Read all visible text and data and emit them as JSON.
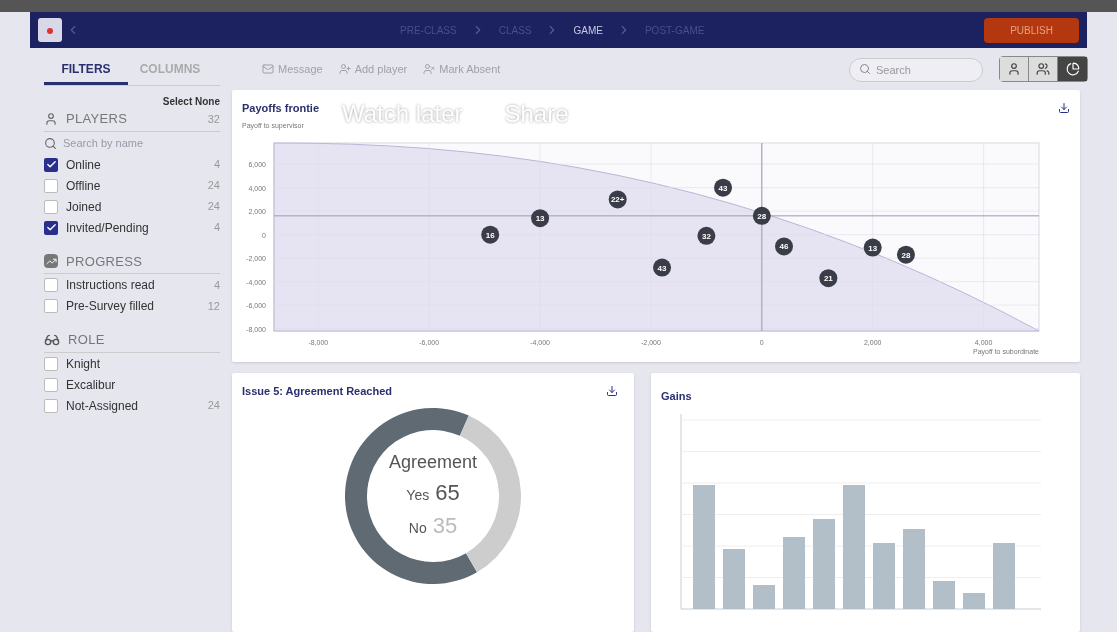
{
  "video_overlay": [
    "Watch later",
    "Share"
  ],
  "nav": {
    "steps": [
      {
        "label": "PRE-CLASS",
        "selected": false
      },
      {
        "label": "CLASS",
        "selected": false
      },
      {
        "label": "GAME",
        "selected": true
      },
      {
        "label": "POST-GAME",
        "selected": false
      }
    ],
    "publish": "PUBLISH"
  },
  "sidebar": {
    "tabs": [
      {
        "label": "FILTERS",
        "selected": true
      },
      {
        "label": "COLUMNS",
        "selected": false
      }
    ],
    "select_none": "Select None",
    "groups": [
      {
        "kind": "players",
        "title": "PLAYERS",
        "count": "32",
        "search_placeholder": "Search by name",
        "items": [
          {
            "label": "Online",
            "count": "4",
            "checked": true
          },
          {
            "label": "Offline",
            "count": "24",
            "checked": false
          },
          {
            "label": "Joined",
            "count": "24",
            "checked": false
          },
          {
            "label": "Invited/Pending",
            "count": "4",
            "checked": true
          }
        ]
      },
      {
        "kind": "progress",
        "title": "PROGRESS",
        "items": [
          {
            "label": "Instructions read",
            "count": "4",
            "checked": false
          },
          {
            "label": "Pre-Survey filled",
            "count": "12",
            "checked": false
          }
        ]
      },
      {
        "kind": "role",
        "title": "ROLE",
        "items": [
          {
            "label": "Knight",
            "checked": false
          },
          {
            "label": "Excalibur",
            "checked": false
          },
          {
            "label": "Not-Assigned",
            "count": "24",
            "checked": false
          }
        ]
      }
    ]
  },
  "toolbar": {
    "actions": [
      {
        "kind": "message",
        "label": "Message"
      },
      {
        "kind": "add",
        "label": "Add player"
      },
      {
        "kind": "absent",
        "label": "Mark Absent"
      }
    ],
    "search_placeholder": "Search",
    "views": [
      {
        "kind": "single",
        "selected": false
      },
      {
        "kind": "group",
        "selected": false
      },
      {
        "kind": "chart",
        "selected": true
      }
    ]
  },
  "scatter_card": {
    "title": "Payoffs frontie",
    "chart_data": {
      "type": "scatter",
      "ylabel": "Payoff to supervisor",
      "xlabel": "Payoff to subordinate",
      "xlim": [
        -8800,
        5000
      ],
      "ylim": [
        -8200,
        7800
      ],
      "xticks": [
        {
          "value": -8000,
          "label": "-8,000"
        },
        {
          "value": -6000,
          "label": "-6,000"
        },
        {
          "value": -4000,
          "label": "-4,000"
        },
        {
          "value": -2000,
          "label": "-2,000"
        },
        {
          "value": 0,
          "label": "0"
        },
        {
          "value": 2000,
          "label": "2,000"
        },
        {
          "value": 4000,
          "label": "4,000"
        }
      ],
      "yticks": [
        {
          "value": 6000,
          "label": "6,000"
        },
        {
          "value": 4000,
          "label": "4,000"
        },
        {
          "value": 2000,
          "label": "2,000"
        },
        {
          "value": 0,
          "label": "0"
        },
        {
          "value": -2000,
          "label": "-2,000"
        },
        {
          "value": -4000,
          "label": "-4,000"
        },
        {
          "value": -6000,
          "label": "-6,000"
        },
        {
          "value": -8000,
          "label": "-8,000"
        }
      ],
      "grid": true,
      "ref_lines": [
        {
          "axis": "y",
          "value": 1600
        },
        {
          "axis": "x",
          "value": 0
        }
      ],
      "x": [
        -4900,
        -4000,
        -2600,
        -1800,
        -1000,
        -700,
        0,
        400,
        1200,
        2000,
        2600
      ],
      "values": [
        0,
        1400,
        3000,
        -2800,
        -100,
        4000,
        1600,
        -1000,
        -3700,
        -1100,
        -1700
      ],
      "annotations": [
        {
          "x": -4900,
          "y": 0,
          "text": "16"
        },
        {
          "x": -4000,
          "y": 1400,
          "text": "13"
        },
        {
          "x": -2600,
          "y": 3000,
          "text": "22+"
        },
        {
          "x": -1800,
          "y": -2800,
          "text": "43"
        },
        {
          "x": -1000,
          "y": -100,
          "text": "32"
        },
        {
          "x": -700,
          "y": 4000,
          "text": "43"
        },
        {
          "x": 0,
          "y": 1600,
          "text": "28"
        },
        {
          "x": 400,
          "y": -1000,
          "text": "46"
        },
        {
          "x": 1200,
          "y": -3700,
          "text": "21"
        },
        {
          "x": 2000,
          "y": -1100,
          "text": "13"
        },
        {
          "x": 2600,
          "y": -1700,
          "text": "28"
        }
      ]
    }
  },
  "agreement_card": {
    "title": "Issue 5: Agreement Reached",
    "center_title": "Agreement",
    "chart_data": {
      "type": "donut",
      "categories": [
        "Yes",
        "No"
      ],
      "values": [
        65,
        35
      ],
      "value_labels": [
        "65",
        "35"
      ]
    }
  },
  "gains_card": {
    "title": "Gains"
  }
}
